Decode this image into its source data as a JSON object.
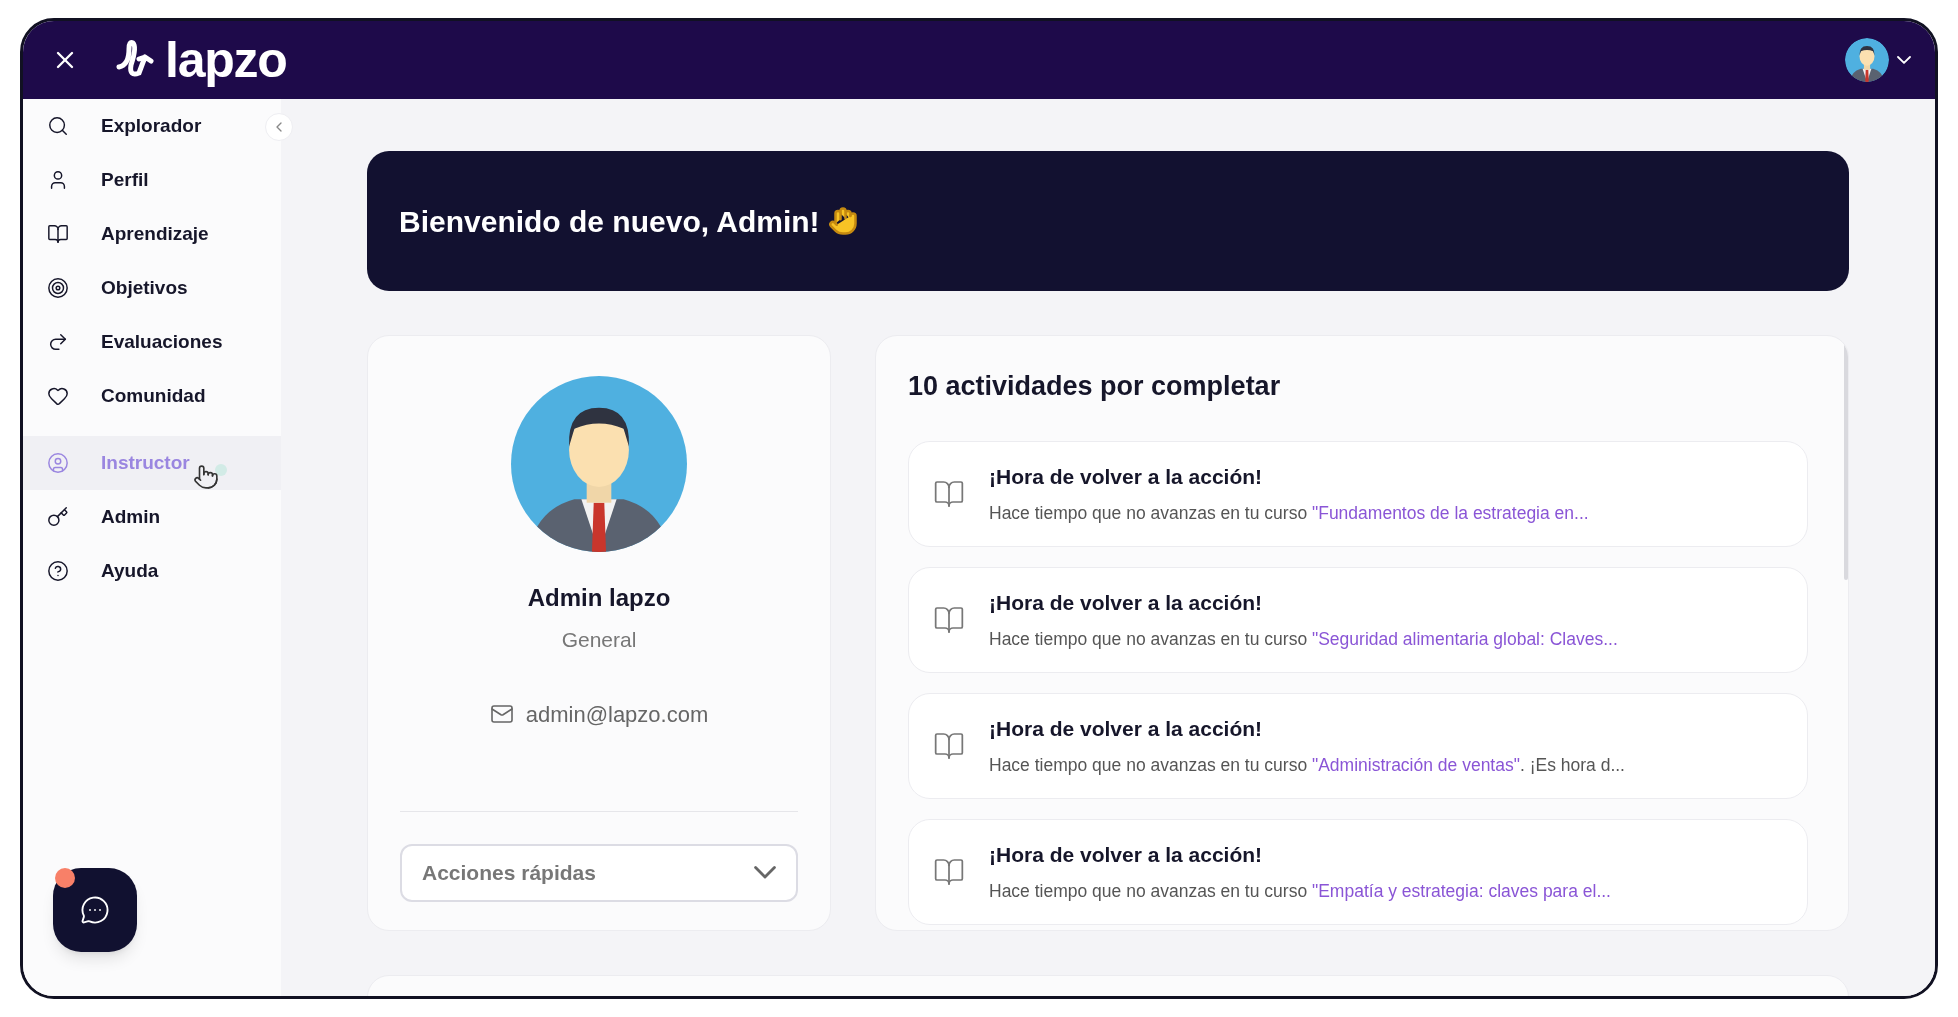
{
  "header": {
    "logo_text": "lapzo"
  },
  "sidebar": {
    "items": [
      {
        "label": "Explorador",
        "hovered": false
      },
      {
        "label": "Perfil",
        "hovered": false
      },
      {
        "label": "Aprendizaje",
        "hovered": false
      },
      {
        "label": "Objetivos",
        "hovered": false
      },
      {
        "label": "Evaluaciones",
        "hovered": false
      },
      {
        "label": "Comunidad",
        "hovered": false
      },
      {
        "label": "Instructor",
        "hovered": true
      },
      {
        "label": "Admin",
        "hovered": false
      },
      {
        "label": "Ayuda",
        "hovered": false
      }
    ]
  },
  "welcome": {
    "title": "Bienvenido de nuevo, Admin!"
  },
  "profile": {
    "name": "Admin lapzo",
    "role": "General",
    "email": "admin@lapzo.com",
    "quick_actions": {
      "placeholder": "Acciones rápidas"
    }
  },
  "activities": {
    "title": "10 actividades por completar",
    "items": [
      {
        "title": "¡Hora de volver a la acción!",
        "prefix": "Hace tiempo que no avanzas en tu curso ",
        "course": "\"Fundamentos de la estrategia en..."
      },
      {
        "title": "¡Hora de volver a la acción!",
        "prefix": "Hace tiempo que no avanzas en tu curso ",
        "course": "\"Seguridad alimentaria global: Claves..."
      },
      {
        "title": "¡Hora de volver a la acción!",
        "prefix": "Hace tiempo que no avanzas en tu curso ",
        "course": "\"Administración de ventas\"",
        "suffix": ". ¡Es hora d..."
      },
      {
        "title": "¡Hora de volver a la acción!",
        "prefix": "Hace tiempo que no avanzas en tu curso ",
        "course": "\"Empatía y estrategia: claves para el..."
      }
    ]
  }
}
